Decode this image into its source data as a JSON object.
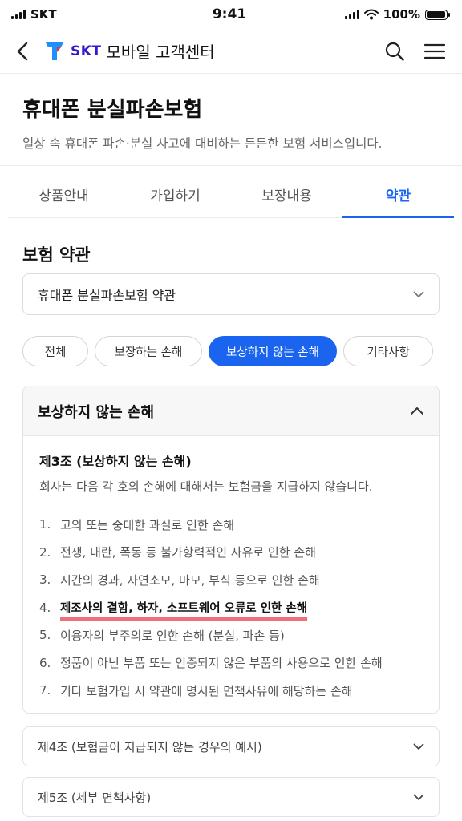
{
  "status_bar": {
    "carrier": "SKT",
    "time": "9:41",
    "battery": "100%",
    "battery_level": 1.0
  },
  "header": {
    "logo_text": "SKT",
    "title": "모바일 고객센터"
  },
  "page": {
    "title": "휴대폰 분실파손보험",
    "subtitle": "일상 속 휴대폰 파손·분실 사고에 대비하는 든든한 보험 서비스입니다."
  },
  "tabs": [
    {
      "label": "상품안내"
    },
    {
      "label": "가입하기"
    },
    {
      "label": "보장내용"
    },
    {
      "label": "약관",
      "active": true
    }
  ],
  "terms": {
    "section_title": "보험 약관",
    "document_select": "휴대폰 분실파손보험 약관",
    "filters": [
      {
        "label": "전체"
      },
      {
        "label": "보장하는 손해"
      },
      {
        "label": "보상하지 않는 손해",
        "active": true
      },
      {
        "label": "기타사항"
      }
    ],
    "open_accordion": {
      "title": "보상하지 않는 손해",
      "article_title": "제3조 (보상하지 않는 손해)",
      "intro": "회사는 다음 각 호의 손해에 대해서는 보험금을 지급하지 않습니다.",
      "items": [
        {
          "num": "1.",
          "text": "고의 또는 중대한 과실로 인한 손해"
        },
        {
          "num": "2.",
          "text": "전쟁, 내란, 폭동 등 불가항력적인 사유로 인한 손해"
        },
        {
          "num": "3.",
          "text": "시간의 경과, 자연소모, 마모, 부식 등으로 인한 손해"
        },
        {
          "num": "4.",
          "text": "제조사의 결함, 하자, 소프트웨어 오류로 인한 손해",
          "highlighted": true
        },
        {
          "num": "5.",
          "text": "이용자의 부주의로 인한 손해 (분실, 파손 등)"
        },
        {
          "num": "6.",
          "text": "정품이 아닌 부품 또는 인증되지 않은 부품의 사용으로 인한 손해"
        },
        {
          "num": "7.",
          "text": "기타 보험가입 시 약관에 명시된 면책사유에 해당하는 손해"
        }
      ]
    },
    "closed_accordions": [
      {
        "title": "제4조 (보험금이 지급되지 않는 경우의 예시)"
      },
      {
        "title": "제5조 (세부 면책사항)"
      }
    ]
  },
  "colors": {
    "accent": "#1a64f0",
    "brand": "#3617ce",
    "highlight_underline": "#ef6f79"
  },
  "icons": [
    "back-arrow-icon",
    "skt-logo-icon",
    "search-icon",
    "menu-icon",
    "chevron-down-icon",
    "chevron-up-icon",
    "signal-icon",
    "wifi-icon",
    "battery-icon"
  ]
}
